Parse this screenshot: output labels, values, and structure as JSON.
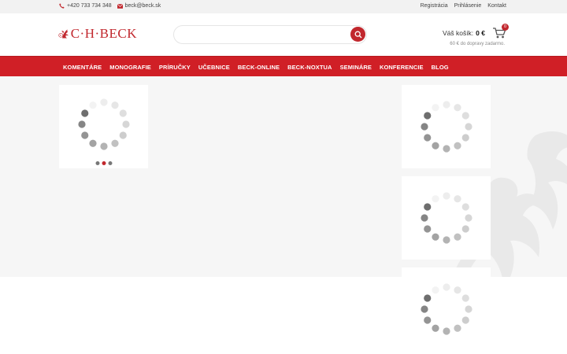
{
  "topbar": {
    "phone": "+420 733 734 348",
    "email": "beck@beck.sk",
    "links": [
      "Registrácia",
      "Prihlásenie",
      "Kontakt"
    ]
  },
  "header": {
    "logo_text": "C·H·BECK",
    "search_placeholder": "",
    "cart_label": "Váš košík:",
    "cart_total": "0 €",
    "cart_count": "0",
    "shipping_note": "60 € do dopravy zadarmo."
  },
  "nav": {
    "items": [
      "KOMENTÁRE",
      "MONOGRAFIE",
      "PRÍRUČKY",
      "UČEBNICE",
      "BECK-ONLINE",
      "BECK-NOXTUA",
      "SEMINÁRE",
      "KONFERENCIE",
      "BLOG"
    ]
  },
  "slider": {
    "dot_count": 3,
    "active_dot": 1
  },
  "colors": {
    "brand_red": "#d01f26",
    "logo_red": "#c1272d",
    "content_bg": "#f6f6f6"
  },
  "icons": [
    "phone-icon",
    "mail-icon",
    "search-icon",
    "cart-icon",
    "loading-spinner-icon",
    "griffin-watermark-icon"
  ]
}
